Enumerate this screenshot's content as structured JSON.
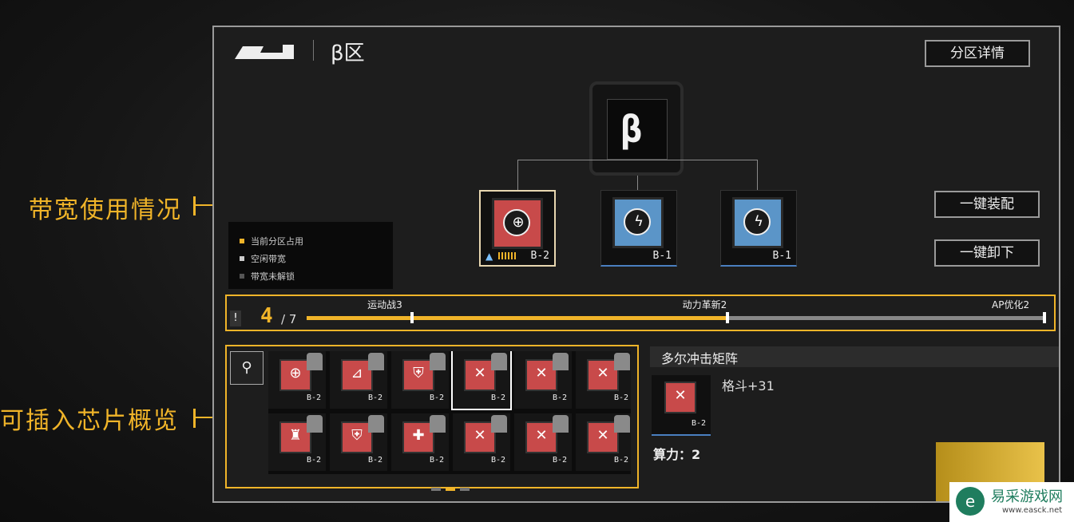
{
  "annotations": {
    "bandwidth_label": "带宽使用情况",
    "chips_label": "可插入芯片概览"
  },
  "header": {
    "zone_title": "β区",
    "detail_button": "分区详情"
  },
  "hub": {
    "glyph": "β"
  },
  "slots": [
    {
      "code": "B-2",
      "color": "red",
      "icon": "crosshair-icon"
    },
    {
      "code": "B-1",
      "color": "blue",
      "icon": "lightning-icon"
    },
    {
      "code": "B-1",
      "color": "blue",
      "icon": "lightning-icon"
    }
  ],
  "actions": {
    "equip_all": "一键装配",
    "unequip_all": "一键卸下"
  },
  "legend": [
    {
      "label": "当前分区占用",
      "color": "#f0b429"
    },
    {
      "label": "空闲带宽",
      "color": "#cccccc"
    },
    {
      "label": "带宽未解锁",
      "color": "#555555"
    }
  ],
  "bandwidth": {
    "used": "4",
    "total": "/ 7",
    "used_fraction": 0.57,
    "markers": [
      {
        "label": "运动战3",
        "fraction": 0.143
      },
      {
        "label": "动力革新2",
        "fraction": 0.57
      },
      {
        "label": "AP优化2",
        "fraction": 1.0
      }
    ]
  },
  "inventory": {
    "chips": [
      {
        "code": "B-2",
        "sym": "⊕",
        "row": 0,
        "col": 0
      },
      {
        "code": "B-2",
        "sym": "⊿",
        "row": 0,
        "col": 1
      },
      {
        "code": "B-2",
        "sym": "⛨",
        "row": 0,
        "col": 2
      },
      {
        "code": "B-2",
        "sym": "✕",
        "row": 0,
        "col": 3
      },
      {
        "code": "B-2",
        "sym": "✕",
        "row": 0,
        "col": 4
      },
      {
        "code": "B-2",
        "sym": "✕",
        "row": 0,
        "col": 5
      },
      {
        "code": "B-2",
        "sym": "♜",
        "row": 1,
        "col": 0
      },
      {
        "code": "B-2",
        "sym": "⛨",
        "row": 1,
        "col": 1
      },
      {
        "code": "B-2",
        "sym": "✚",
        "row": 1,
        "col": 2
      },
      {
        "code": "B-2",
        "sym": "✕",
        "row": 1,
        "col": 3
      },
      {
        "code": "B-2",
        "sym": "✕",
        "row": 1,
        "col": 4
      },
      {
        "code": "B-2",
        "sym": "✕",
        "row": 1,
        "col": 5
      }
    ]
  },
  "detail": {
    "name": "多尔冲击矩阵",
    "stat": "格斗+31",
    "chip_code": "B-2",
    "power": "算力：2"
  },
  "watermark": {
    "name": "易采游戏网",
    "url": "www.easck.net"
  }
}
